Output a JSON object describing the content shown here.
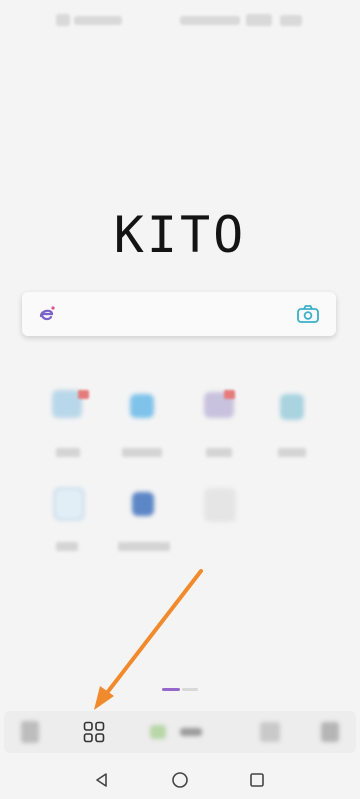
{
  "app": {
    "logo_text": "KITO"
  },
  "search": {
    "value": "",
    "placeholder": ""
  },
  "icons": {
    "search_engine": "e-logo-icon",
    "camera": "camera-icon",
    "apps_grid": "grid-icon",
    "nav_back": "triangle-back-icon",
    "nav_home": "circle-home-icon",
    "nav_recents": "square-recents-icon"
  },
  "colors": {
    "background": "#f4f4f4",
    "logo": "#141414",
    "accent_camera": "#3bb0c9",
    "search_engine_icon": "#7a63c9",
    "page_indicator_active": "#9467c8",
    "annotation_arrow": "#f08a2c"
  },
  "pager": {
    "pages": 2,
    "current": 1
  }
}
